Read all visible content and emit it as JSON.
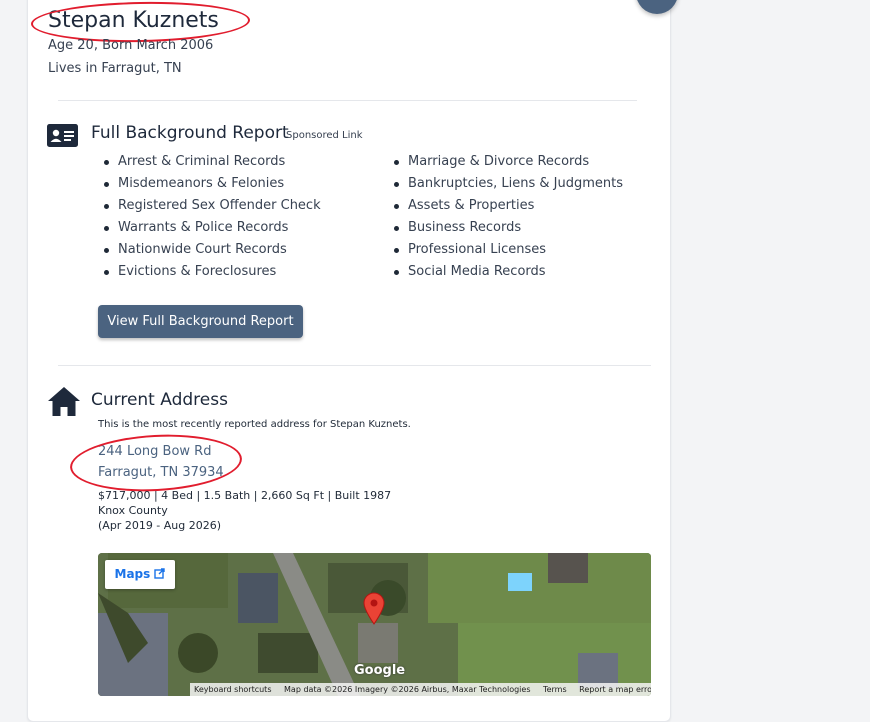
{
  "profile": {
    "name": "Stepan Kuznets",
    "age_born": "Age 20, Born March 2006",
    "lives_in": "Lives in Farragut, TN"
  },
  "background": {
    "title": "Full Background Report",
    "sponsored": "Sponsored Link",
    "left_items": [
      "Arrest & Criminal Records",
      "Misdemeanors & Felonies",
      "Registered Sex Offender Check",
      "Warrants & Police Records",
      "Nationwide Court Records",
      "Evictions & Foreclosures"
    ],
    "right_items": [
      "Marriage & Divorce Records",
      "Bankruptcies, Liens & Judgments",
      "Assets & Properties",
      "Business Records",
      "Professional Licenses",
      "Social Media Records"
    ],
    "button_label": "View Full Background Report"
  },
  "address": {
    "title": "Current Address",
    "description": "This is the most recently reported address for Stepan Kuznets.",
    "street": "244 Long Bow Rd",
    "city_line": "Farragut, TN 37934",
    "details": "$717,000 | 4 Bed | 1.5 Bath | 2,660 Sq Ft | Built 1987",
    "county": "Knox County",
    "date_range": "(Apr 2019 - Aug 2026)"
  },
  "map": {
    "maps_button": "Maps",
    "google_logo": "Google",
    "attribution": {
      "shortcuts": "Keyboard shortcuts",
      "data": "Map data ©2026 Imagery ©2026 Airbus, Maxar Technologies",
      "terms": "Terms",
      "report": "Report a map error"
    }
  },
  "colors": {
    "accent": "#4b6380",
    "annotation_red": "#e11d2e"
  },
  "icons": {
    "report": "id-card-icon",
    "address": "house-icon",
    "external": "external-link-icon",
    "pin": "map-pin-icon"
  }
}
